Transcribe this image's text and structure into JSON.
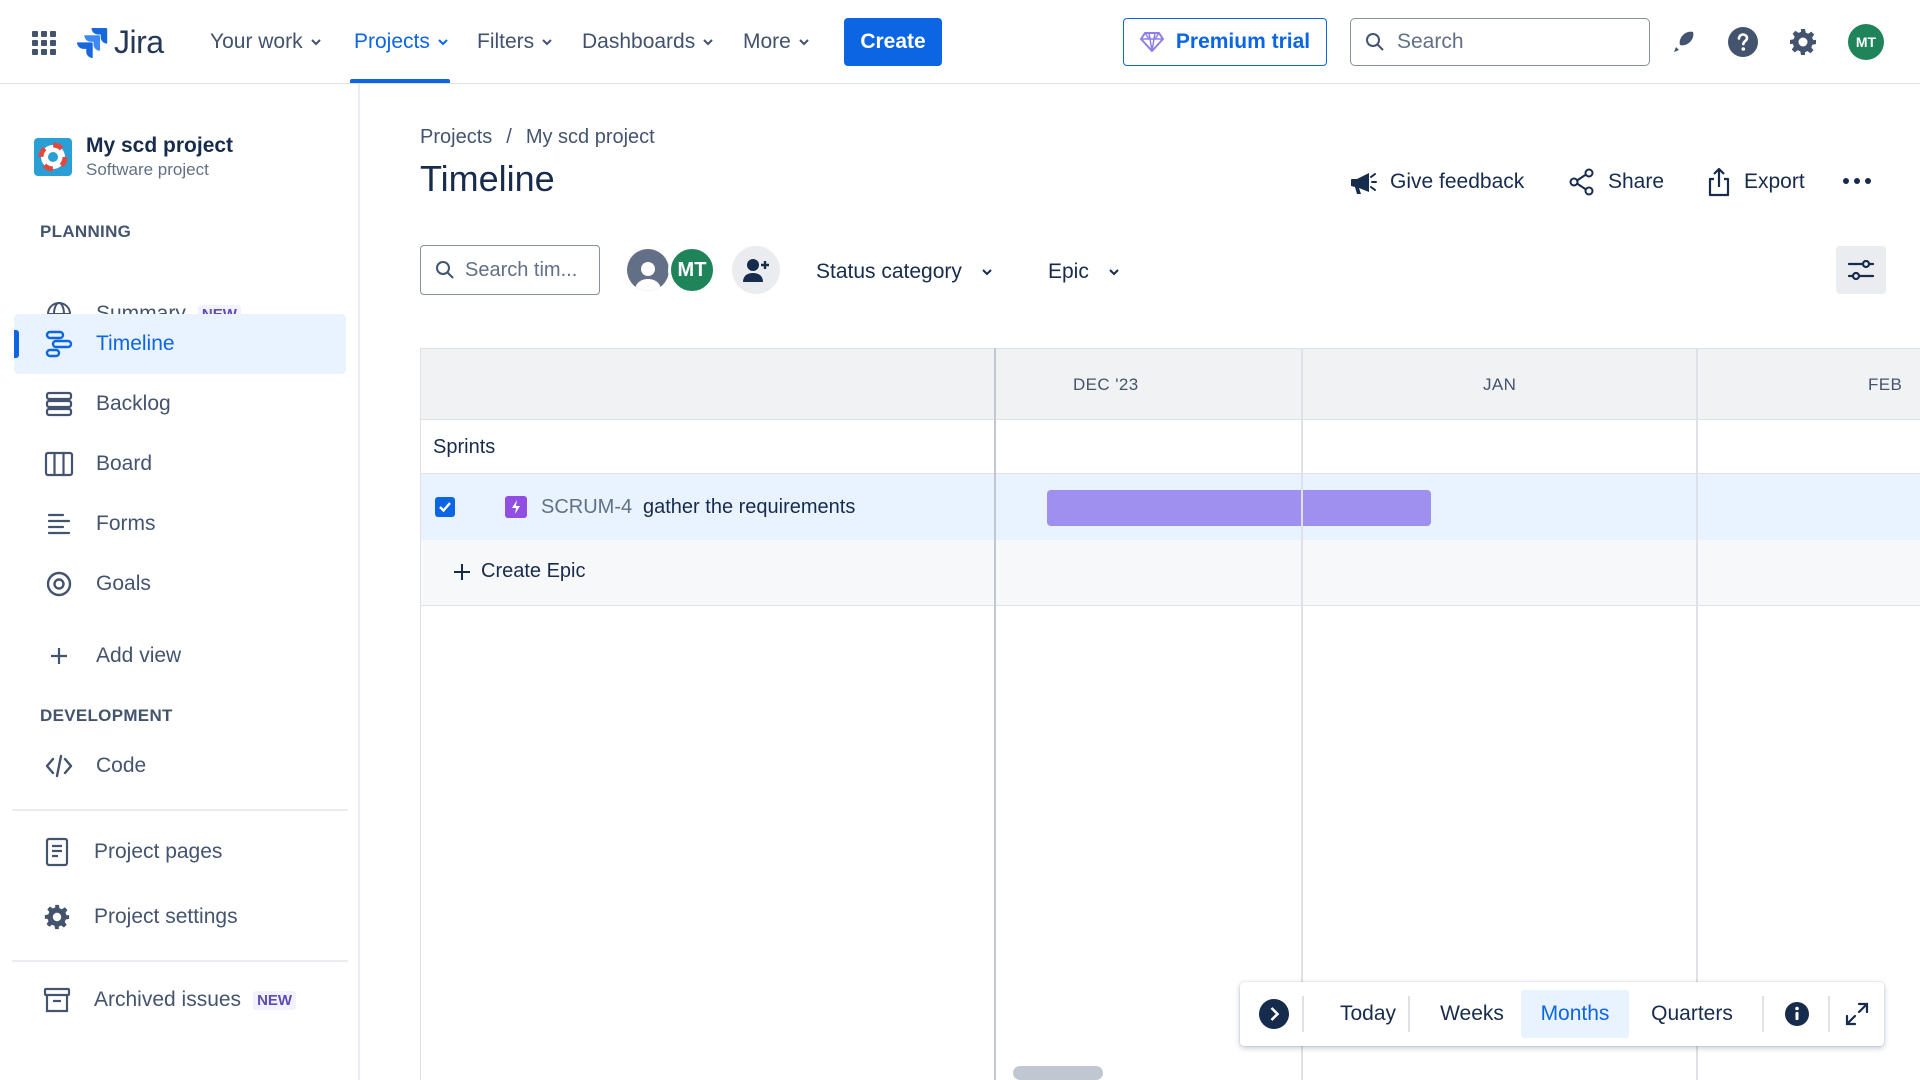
{
  "topnav": {
    "logo_text": "Jira",
    "items": [
      {
        "label": "Your work"
      },
      {
        "label": "Projects"
      },
      {
        "label": "Filters"
      },
      {
        "label": "Dashboards"
      },
      {
        "label": "More"
      }
    ],
    "active_item": "Projects",
    "create_label": "Create",
    "premium_label": "Premium trial",
    "search_placeholder": "Search",
    "user_initials": "MT",
    "colors": {
      "accent": "#0c66e4",
      "avatar": "#1f845a"
    }
  },
  "sidebar": {
    "project_name": "My scd project",
    "project_type": "Software project",
    "planning_header": "PLANNING",
    "planning_items": [
      {
        "label": "Summary",
        "icon": "globe-icon",
        "badge": "NEW"
      },
      {
        "label": "Timeline",
        "icon": "timeline-icon",
        "active": true
      },
      {
        "label": "Backlog",
        "icon": "backlog-icon"
      },
      {
        "label": "Board",
        "icon": "board-icon"
      },
      {
        "label": "Forms",
        "icon": "forms-icon"
      },
      {
        "label": "Goals",
        "icon": "goals-icon"
      }
    ],
    "add_view_label": "Add view",
    "development_header": "DEVELOPMENT",
    "code_label": "Code",
    "project_pages_label": "Project pages",
    "project_settings_label": "Project settings",
    "archived_label": "Archived issues",
    "archived_badge": "NEW"
  },
  "main": {
    "breadcrumb": {
      "root": "Projects",
      "separator": "/",
      "current": "My scd project"
    },
    "title": "Timeline",
    "actions": {
      "feedback": "Give feedback",
      "share": "Share",
      "export": "Export"
    },
    "filters": {
      "search_placeholder": "Search tim...",
      "assignee_initials": "MT",
      "status_category": "Status category",
      "epic": "Epic"
    }
  },
  "timeline": {
    "months": [
      "DEC '23",
      "JAN",
      "FEB"
    ],
    "sprints_label": "Sprints",
    "epics": [
      {
        "key": "SCRUM-4",
        "summary": "gather the requirements",
        "checked": true,
        "bar_color": "#9f8fef"
      }
    ],
    "create_epic_label": "Create Epic"
  },
  "zoom": {
    "today": "Today",
    "weeks": "Weeks",
    "months": "Months",
    "quarters": "Quarters",
    "selected": "Months"
  }
}
